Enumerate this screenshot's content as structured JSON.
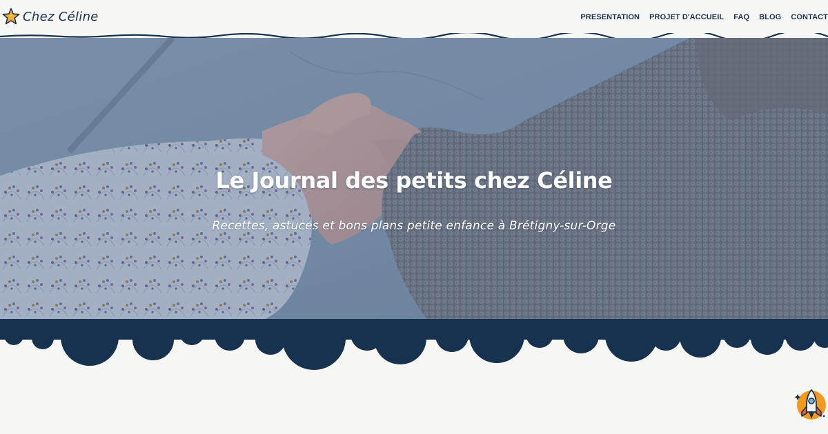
{
  "site": {
    "logo_text": "Chez Céline"
  },
  "nav": {
    "items": [
      {
        "label": "PRESENTATION"
      },
      {
        "label": "PROJET D'ACCUEIL"
      },
      {
        "label": "FAQ"
      },
      {
        "label": "BLOG"
      },
      {
        "label": "CONTACT"
      }
    ]
  },
  "hero": {
    "title": "Le Journal des petits chez Céline",
    "subtitle": "Recettes, astuces et bons plans petite enfance à Brétigny-sur-Orge"
  },
  "colors": {
    "navy": "#16324f",
    "background": "#f6f6f4",
    "star": "#f2b23b",
    "rocket_badge": "#f39a1e"
  },
  "icons": {
    "logo": "star-icon",
    "back_to_top": "rocket-icon"
  }
}
